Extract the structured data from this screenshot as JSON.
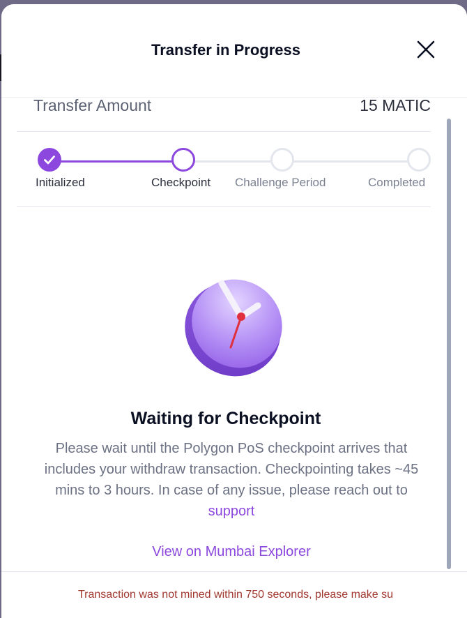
{
  "header": {
    "title": "Transfer in Progress",
    "close_icon": "close-icon"
  },
  "transfer": {
    "amount_label": "Transfer Amount",
    "amount_value": "15 MATIC"
  },
  "stepper": {
    "steps": [
      {
        "label": "Initialized",
        "state": "completed",
        "icon": "check-icon"
      },
      {
        "label": "Checkpoint",
        "state": "active"
      },
      {
        "label": "Challenge Period",
        "state": "pending"
      },
      {
        "label": "Completed",
        "state": "pending"
      }
    ]
  },
  "status": {
    "illustration": "clock-icon",
    "title": "Waiting for Checkpoint",
    "description": "Please wait until the Polygon PoS checkpoint arrives that includes your withdraw transaction. Checkpointing takes ~45 mins to 3 hours. In case of any issue, please reach out to",
    "support_link": "support",
    "explorer_link": "View on Mumbai Explorer"
  },
  "footer": {
    "error_message": "Transaction was not mined within 750 seconds, please make su"
  },
  "colors": {
    "accent": "#8c47de",
    "title": "#0b1023",
    "muted": "#6b7183",
    "error": "#a1362d",
    "track": "#e3e6ec"
  }
}
